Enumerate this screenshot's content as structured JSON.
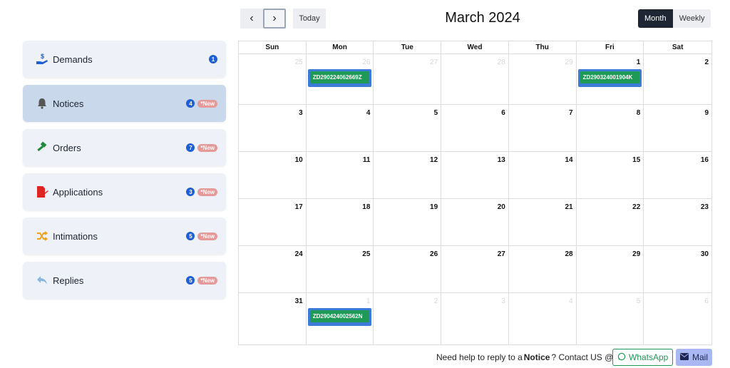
{
  "sidebar": {
    "items": [
      {
        "label": "Demands",
        "count": "1",
        "new": "",
        "icon": "hand-money-icon"
      },
      {
        "label": "Notices",
        "count": "4",
        "new": "*New",
        "icon": "bell-icon"
      },
      {
        "label": "Orders",
        "count": "7",
        "new": "*New",
        "icon": "gavel-icon"
      },
      {
        "label": "Applications",
        "count": "3",
        "new": "*New",
        "icon": "file-pen-icon"
      },
      {
        "label": "Intimations",
        "count": "5",
        "new": "*New",
        "icon": "shuffle-icon"
      },
      {
        "label": "Replies",
        "count": "5",
        "new": "*New",
        "icon": "reply-icon"
      }
    ]
  },
  "toolbar": {
    "prev_label": "‹",
    "next_label": "›",
    "today_label": "Today",
    "title": "March 2024",
    "month_label": "Month",
    "weekly_label": "Weekly"
  },
  "calendar": {
    "days_of_week": [
      "Sun",
      "Mon",
      "Tue",
      "Wed",
      "Thu",
      "Fri",
      "Sat"
    ],
    "weeks": [
      [
        "25",
        "26",
        "27",
        "28",
        "29",
        "1",
        "2"
      ],
      [
        "3",
        "4",
        "5",
        "6",
        "7",
        "8",
        "9"
      ],
      [
        "10",
        "11",
        "12",
        "13",
        "14",
        "15",
        "16"
      ],
      [
        "17",
        "18",
        "19",
        "20",
        "21",
        "22",
        "23"
      ],
      [
        "24",
        "25",
        "26",
        "27",
        "28",
        "29",
        "30"
      ],
      [
        "31",
        "1",
        "2",
        "3",
        "4",
        "5",
        "6"
      ]
    ],
    "events": [
      {
        "week": 0,
        "day": 1,
        "label": "ZD290224062669Z"
      },
      {
        "week": 0,
        "day": 5,
        "label": "ZD290324001904K"
      },
      {
        "week": 5,
        "day": 1,
        "label": "ZD290424002562N"
      }
    ]
  },
  "footer": {
    "help_prefix": "Need help to reply to a",
    "help_bold": "Notice",
    "help_suffix": "? Contact US @",
    "whatsapp_label": "WhatsApp",
    "mail_label": "Mail"
  },
  "colors": {
    "accent": "#1f5fd6",
    "event_outer": "#3d7bd9",
    "event_inner": "#1e9a56",
    "active_card": "#c9d8ea",
    "new_badge": "#e59a9a"
  }
}
